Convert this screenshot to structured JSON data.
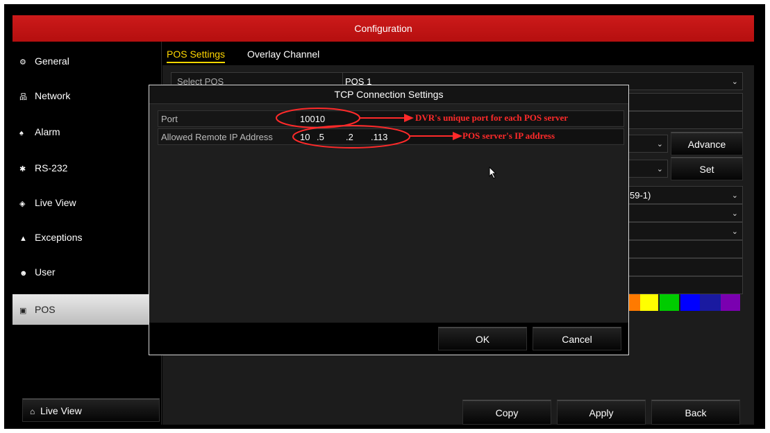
{
  "window": {
    "title": "Configuration"
  },
  "sidebar": {
    "items": [
      {
        "label": "General",
        "icon": "gear-icon",
        "glyph": "⚙"
      },
      {
        "label": "Network",
        "icon": "network-icon",
        "glyph": "🖧"
      },
      {
        "label": "Alarm",
        "icon": "alarm-icon",
        "glyph": "⚠"
      },
      {
        "label": "RS-232",
        "icon": "serial-port-icon",
        "glyph": "⇄"
      },
      {
        "label": "Live View",
        "icon": "eye-icon",
        "glyph": "◉"
      },
      {
        "label": "Exceptions",
        "icon": "warning-icon",
        "glyph": "▲"
      },
      {
        "label": "User",
        "icon": "user-icon",
        "glyph": "👥"
      },
      {
        "label": "POS",
        "icon": "pos-icon",
        "glyph": "⧉"
      }
    ],
    "active": "POS",
    "live_view_button": "Live View"
  },
  "tabs": [
    {
      "label": "POS Settings",
      "active": true
    },
    {
      "label": "Overlay Channel",
      "active": false
    }
  ],
  "background_form": {
    "select_pos_label": "Select POS",
    "select_pos_value": "POS 1",
    "partial_value": "59-1)",
    "advance_button": "Advance",
    "set_button": "Set"
  },
  "colors": {
    "accent": "#c41414",
    "tab_active": "#ffd700",
    "annotation": "#ff2a2a",
    "swatches": [
      "#ff7a00",
      "#ffff00",
      "#00cc00",
      "#0000ff",
      "#1a1aa0",
      "#7a00b0"
    ]
  },
  "modal": {
    "title": "TCP Connection Settings",
    "port_label": "Port",
    "port_value": "10010",
    "ip_label": "Allowed Remote IP Address",
    "ip_octets": [
      "10",
      ".5",
      ".2",
      ".113"
    ],
    "ok_button": "OK",
    "cancel_button": "Cancel"
  },
  "annotations": {
    "port_note": "DVR's unique port for each POS server",
    "ip_note": "POS server's IP address"
  },
  "footer": {
    "copy": "Copy",
    "apply": "Apply",
    "back": "Back"
  }
}
